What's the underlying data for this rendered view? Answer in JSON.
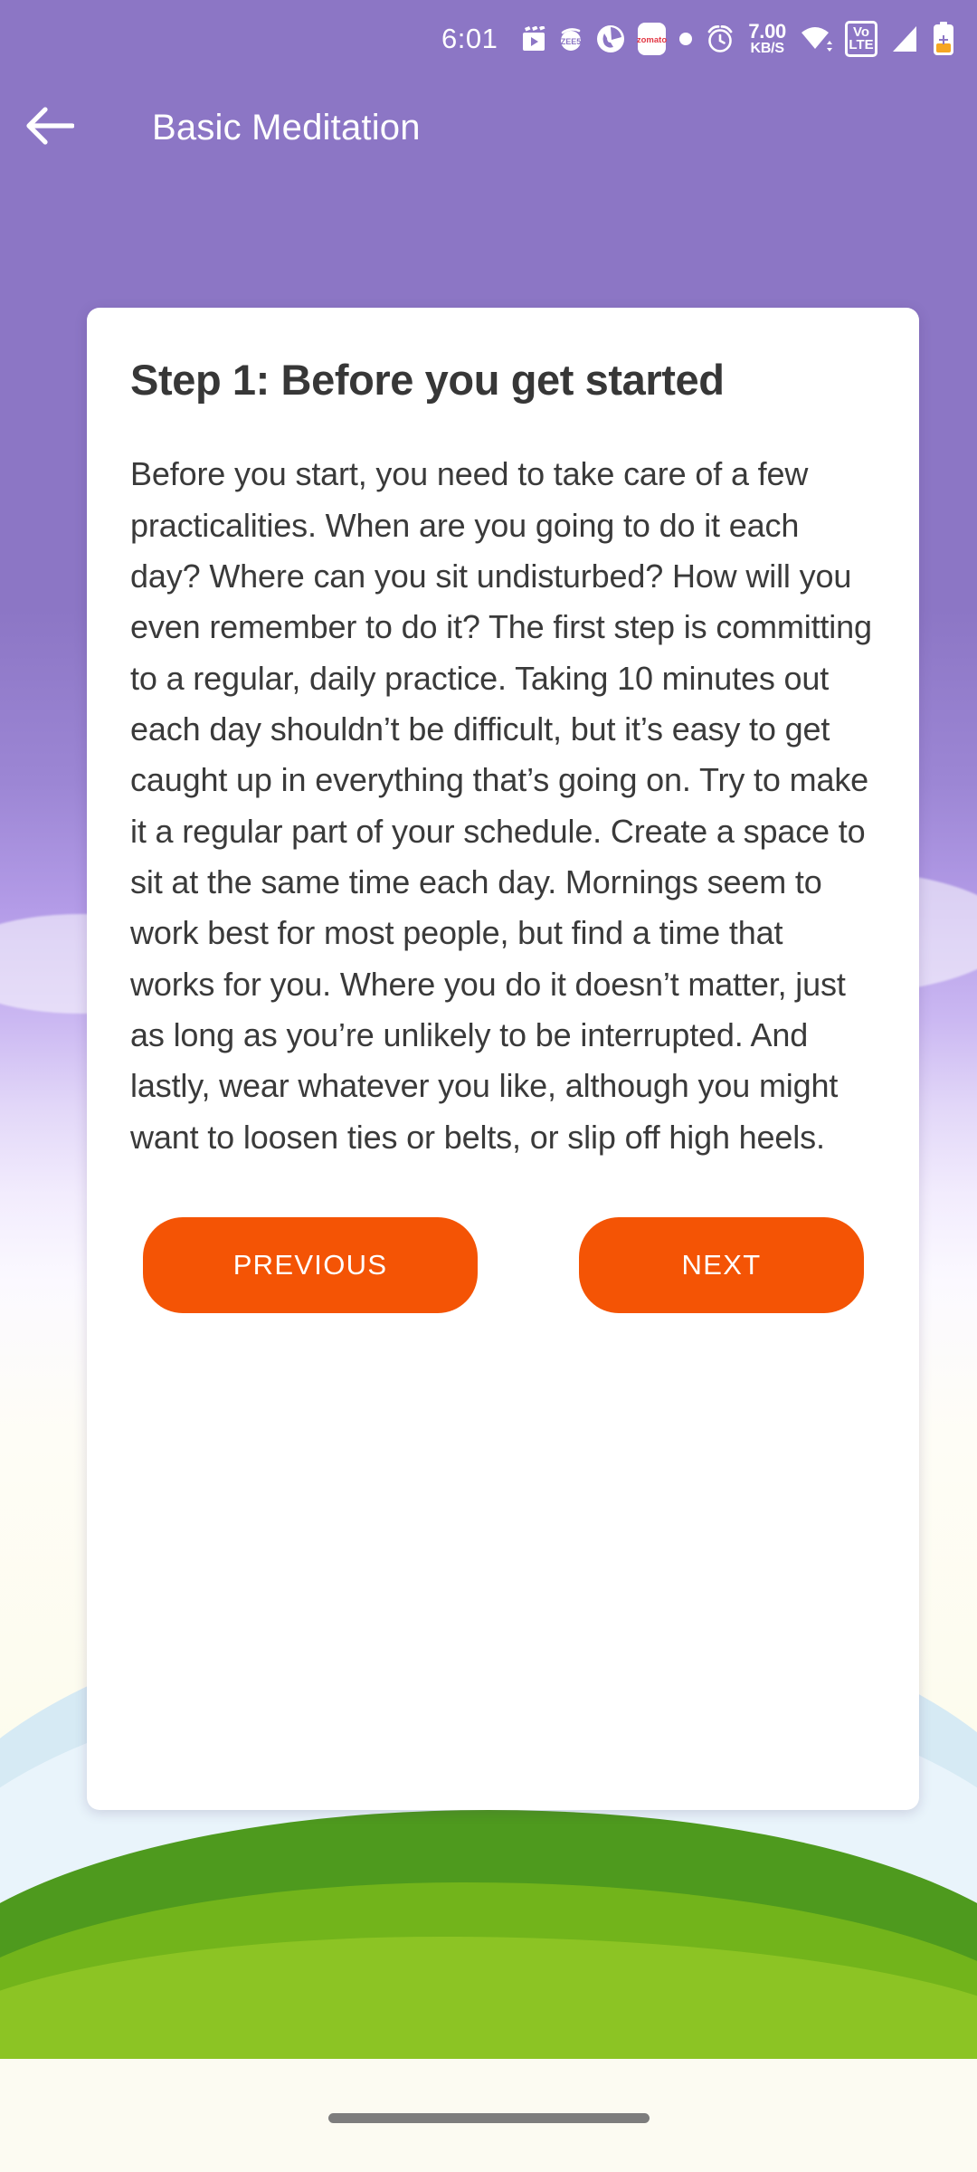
{
  "statusbar": {
    "clock": "6:01",
    "network_speed_value": "7.00",
    "network_speed_unit": "KB/S",
    "volte_line1": "Vo",
    "volte_line2": "LTE",
    "icons": [
      "jiocinema-notification-icon",
      "zee5-notification-icon",
      "phone-app-notification-icon",
      "zomato-notification-icon",
      "more-notifications-dot-icon",
      "alarm-icon",
      "wifi-icon",
      "volte-icon",
      "signal-bars-icon",
      "battery-charging-icon"
    ]
  },
  "appbar": {
    "back_icon": "arrow-left-icon",
    "title": "Basic Meditation"
  },
  "card": {
    "title": "Step 1: Before you get started",
    "body": "Before you start, you need to take care of a few practicalities. When are you going to do it each day? Where can you sit undisturbed? How will you even remember to do it? The first step is committing to a regular, daily practice. Taking 10 minutes out each day shouldn’t be difficult, but it’s easy to get caught up in everything that’s going on. Try to make it a regular part of your schedule. Create a space to sit at the same time each day. Mornings seem to work best for most people, but find a time that works for you. Where you do it doesn’t matter, just as long as you’re unlikely to be interrupted. And lastly, wear whatever you like, although you might want to loosen ties or belts, or slip off high heels.",
    "previous_label": "PREVIOUS",
    "next_label": "NEXT"
  },
  "colors": {
    "appbar_purple": "#8C76C5",
    "button_orange": "#F45405",
    "card_background": "#FFFFFF",
    "title_text": "#373737",
    "body_text": "#3A3A3A",
    "hill_green": "#8CC424",
    "hill_green_dark": "#4E9A1E",
    "sky_blue": "#A8D4EE"
  },
  "navbar": {
    "handle": "gesture-home-handle"
  }
}
